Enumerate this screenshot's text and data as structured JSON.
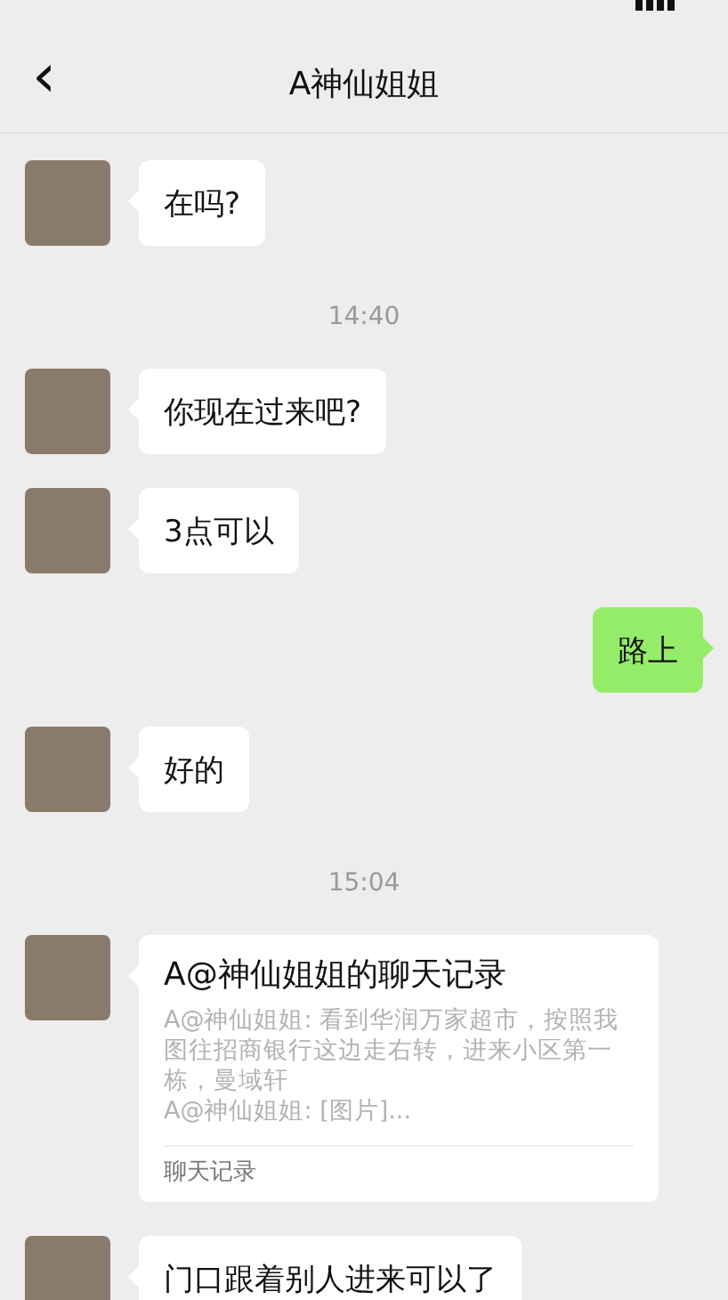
{
  "header": {
    "title": "A神仙姐姐",
    "back": "‹"
  },
  "messages": [
    {
      "kind": "incoming",
      "text": "在吗?"
    },
    {
      "kind": "time",
      "text": "14:40"
    },
    {
      "kind": "incoming",
      "text": "你现在过来吧?"
    },
    {
      "kind": "incoming",
      "text": "3点可以"
    },
    {
      "kind": "outgoing",
      "text": "路上"
    },
    {
      "kind": "incoming",
      "text": "好的"
    },
    {
      "kind": "time",
      "text": "15:04"
    },
    {
      "kind": "record",
      "title": "A@神仙姐姐的聊天记录",
      "lines": [
        "A@神仙姐姐: 看到华润万家超市，按照我图往招商银行这边走右转，进来小区第一栋，曼域轩",
        "A@神仙姐姐: [图片]..."
      ],
      "footer": "聊天记录"
    },
    {
      "kind": "incoming",
      "text": "门口跟着别人进来可以了"
    }
  ]
}
